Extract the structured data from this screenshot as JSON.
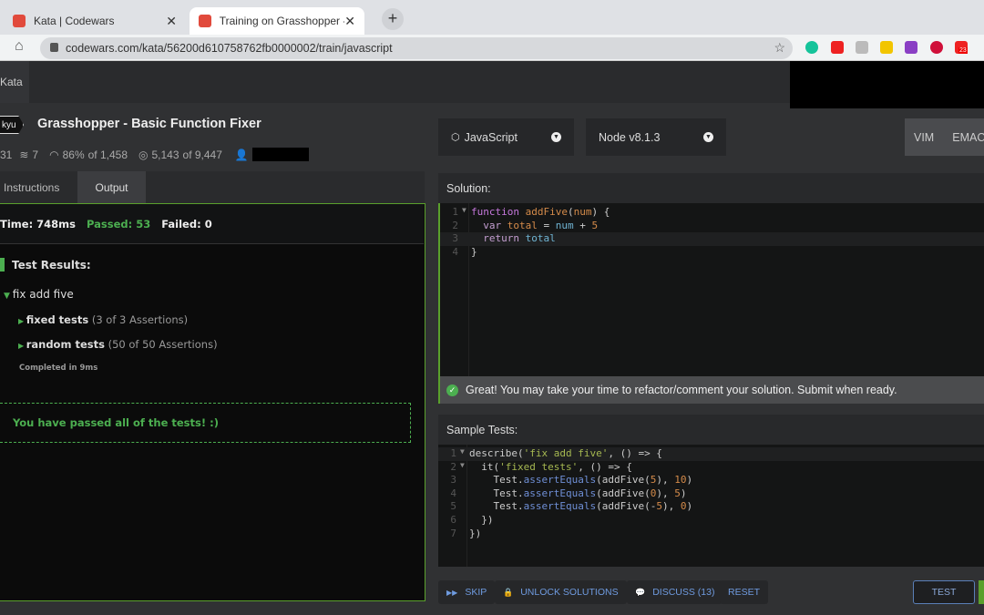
{
  "browser": {
    "tabs": [
      {
        "title": "Kata | Codewars"
      },
      {
        "title": "Training on Grasshopper - Basi"
      }
    ],
    "url": "codewars.com/kata/56200d610758762fb0000002/train/javascript",
    "ext_badge": "23"
  },
  "nav": {
    "kata": "Kata"
  },
  "kata": {
    "kyu": "kyu",
    "title": "Grasshopper - Basic Function Fixer",
    "stats": {
      "a": "31",
      "collections": "7",
      "satisfaction": "86%",
      "of1": "of 1,458",
      "completed": "5,143",
      "of2": "of 9,447"
    }
  },
  "controls": {
    "language": "JavaScript",
    "version": "Node v8.1.3",
    "keybindings": [
      "VIM",
      "EMAC"
    ]
  },
  "left": {
    "tabs": [
      "Instructions",
      "Output"
    ],
    "summary": {
      "time": "Time: 748ms",
      "passed": "Passed: 53",
      "failed": "Failed: 0"
    },
    "results_title": "Test Results:",
    "group": "fix add five",
    "tests": [
      {
        "name": "fixed tests",
        "detail": "(3 of 3 Assertions)"
      },
      {
        "name": "random tests",
        "detail": "(50 of 50 Assertions)"
      }
    ],
    "completed": "Completed in 9ms",
    "passed_msg": "You have passed all of the tests! :)"
  },
  "solution": {
    "header": "Solution:",
    "lines": [
      [
        [
          "kw",
          "function"
        ],
        [
          "pl",
          " "
        ],
        [
          "fn",
          "addFive"
        ],
        [
          "pl",
          "("
        ],
        [
          "fn",
          "num"
        ],
        [
          "pl",
          ") {"
        ]
      ],
      [
        [
          "pl",
          "  "
        ],
        [
          "kw2",
          "var"
        ],
        [
          "pl",
          " "
        ],
        [
          "fn",
          "total"
        ],
        [
          "pl",
          " = "
        ],
        [
          "var",
          "num"
        ],
        [
          "pl",
          " + "
        ],
        [
          "num",
          "5"
        ]
      ],
      [
        [
          "pl",
          "  "
        ],
        [
          "kw2",
          "return"
        ],
        [
          "pl",
          " "
        ],
        [
          "var",
          "total"
        ]
      ],
      [
        [
          "pl",
          "}"
        ]
      ]
    ],
    "message": "Great! You may take your time to refactor/comment your solution. Submit when ready."
  },
  "sample": {
    "header": "Sample Tests:",
    "lines": [
      [
        [
          "pl",
          "describe("
        ],
        [
          "str",
          "'fix add five'"
        ],
        [
          "pl",
          ", () => {"
        ]
      ],
      [
        [
          "pl",
          "  it("
        ],
        [
          "str",
          "'fixed tests'"
        ],
        [
          "pl",
          ", () => {"
        ]
      ],
      [
        [
          "pl",
          "    Test."
        ],
        [
          "meth",
          "assertEquals"
        ],
        [
          "pl",
          "(addFive("
        ],
        [
          "num",
          "5"
        ],
        [
          "pl",
          "), "
        ],
        [
          "num",
          "10"
        ],
        [
          "pl",
          ")"
        ]
      ],
      [
        [
          "pl",
          "    Test."
        ],
        [
          "meth",
          "assertEquals"
        ],
        [
          "pl",
          "(addFive("
        ],
        [
          "num",
          "0"
        ],
        [
          "pl",
          "), "
        ],
        [
          "num",
          "5"
        ],
        [
          "pl",
          ")"
        ]
      ],
      [
        [
          "pl",
          "    Test."
        ],
        [
          "meth",
          "assertEquals"
        ],
        [
          "pl",
          "(addFive(-"
        ],
        [
          "num",
          "5"
        ],
        [
          "pl",
          "), "
        ],
        [
          "num",
          "0"
        ],
        [
          "pl",
          ")"
        ]
      ],
      [
        [
          "pl",
          "  })"
        ]
      ],
      [
        [
          "pl",
          "})"
        ]
      ]
    ]
  },
  "actions": {
    "skip": "SKIP",
    "unlock": "UNLOCK SOLUTIONS",
    "discuss": "DISCUSS (13)",
    "reset": "RESET",
    "test": "TEST"
  },
  "colors": {
    "accent": "#5aa02c",
    "link": "#6f9be0",
    "pass": "#4caf50"
  }
}
